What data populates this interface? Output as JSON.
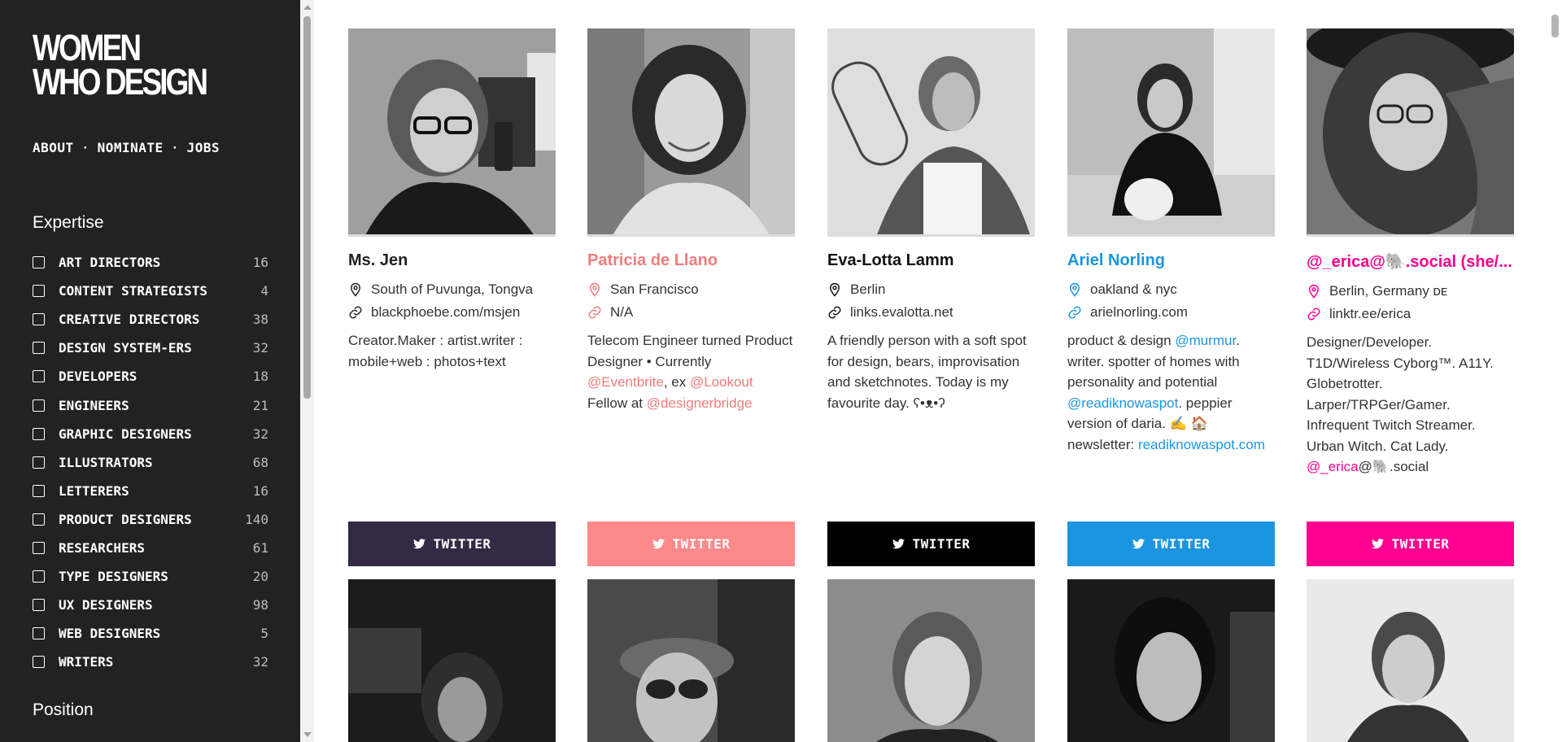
{
  "sidebar": {
    "logo_line1": "WOMEN",
    "logo_line2": "WHO DESIGN",
    "nav": [
      "ABOUT",
      "NOMINATE",
      "JOBS"
    ],
    "nav_separator": "·",
    "expertise_title": "Expertise",
    "position_title": "Position",
    "filters": [
      {
        "label": "ART DIRECTORS",
        "count": "16"
      },
      {
        "label": "CONTENT STRATEGISTS",
        "count": "4"
      },
      {
        "label": "CREATIVE DIRECTORS",
        "count": "38"
      },
      {
        "label": "DESIGN SYSTEM-ERS",
        "count": "32"
      },
      {
        "label": "DEVELOPERS",
        "count": "18"
      },
      {
        "label": "ENGINEERS",
        "count": "21"
      },
      {
        "label": "GRAPHIC DESIGNERS",
        "count": "32"
      },
      {
        "label": "ILLUSTRATORS",
        "count": "68"
      },
      {
        "label": "LETTERERS",
        "count": "16"
      },
      {
        "label": "PRODUCT DESIGNERS",
        "count": "140"
      },
      {
        "label": "RESEARCHERS",
        "count": "61"
      },
      {
        "label": "TYPE DESIGNERS",
        "count": "20"
      },
      {
        "label": "UX DESIGNERS",
        "count": "98"
      },
      {
        "label": "WEB DESIGNERS",
        "count": "5"
      },
      {
        "label": "WRITERS",
        "count": "32"
      }
    ]
  },
  "cards": [
    {
      "name": "Ms. Jen",
      "location": "South of Puvunga, Tongva",
      "website": "blackphoebe.com/msjen",
      "bio": "Creator.Maker : artist.writer : mobile+web : photos+text",
      "button": "TWITTER",
      "accent": "#352a45",
      "name_color": "#222222",
      "icon_color": "#222222"
    },
    {
      "name": "Patricia de Llano",
      "location": "San Francisco",
      "website": "N/A",
      "bio_parts": [
        "Telecom Engineer turned Product Designer • Currently ",
        "@Eventbrite",
        ", ex ",
        "@Lookout",
        " Fellow at ",
        "@designerbridge"
      ],
      "button": "TWITTER",
      "accent": "#fd8a8a",
      "name_color": "#f07c7c",
      "icon_color": "#f07c7c"
    },
    {
      "name": "Eva-Lotta Lamm",
      "location": "Berlin",
      "website": "links.evalotta.net",
      "bio": "A friendly person with a soft spot for design, bears, improvisation and sketchnotes. Today is my favourite day. ʕ•ᴥ•ʔ",
      "button": "TWITTER",
      "accent": "#000000",
      "name_color": "#111111",
      "icon_color": "#111111"
    },
    {
      "name": "Ariel Norling",
      "location": "oakland & nyc",
      "website": "arielnorling.com",
      "bio_parts": [
        "product & design ",
        "@murmur",
        ". writer. spotter of homes with personality and potential ",
        "@readiknowaspot",
        ". peppier version of daria. ✍️ 🏠 newsletter: ",
        "readiknowaspot.com"
      ],
      "button": "TWITTER",
      "accent": "#1b95e0",
      "name_color": "#1b95e0",
      "icon_color": "#1b95e0"
    },
    {
      "name": "@_erica@🐘.social (she/...",
      "location": "Berlin, Germany ᴅᴇ",
      "website": "linktr.ee/erica",
      "bio_parts": [
        "Designer/Developer. T1D/Wireless Cyborg™. A11Y. Globetrotter. Larper/TRPGer/Gamer. Infrequent Twitch Streamer. Urban Witch. Cat Lady. ",
        "@_erica",
        "@🐘.social"
      ],
      "button": "TWITTER",
      "accent": "#ff0090",
      "name_color": "#ff0090",
      "icon_color": "#ff0090"
    }
  ]
}
